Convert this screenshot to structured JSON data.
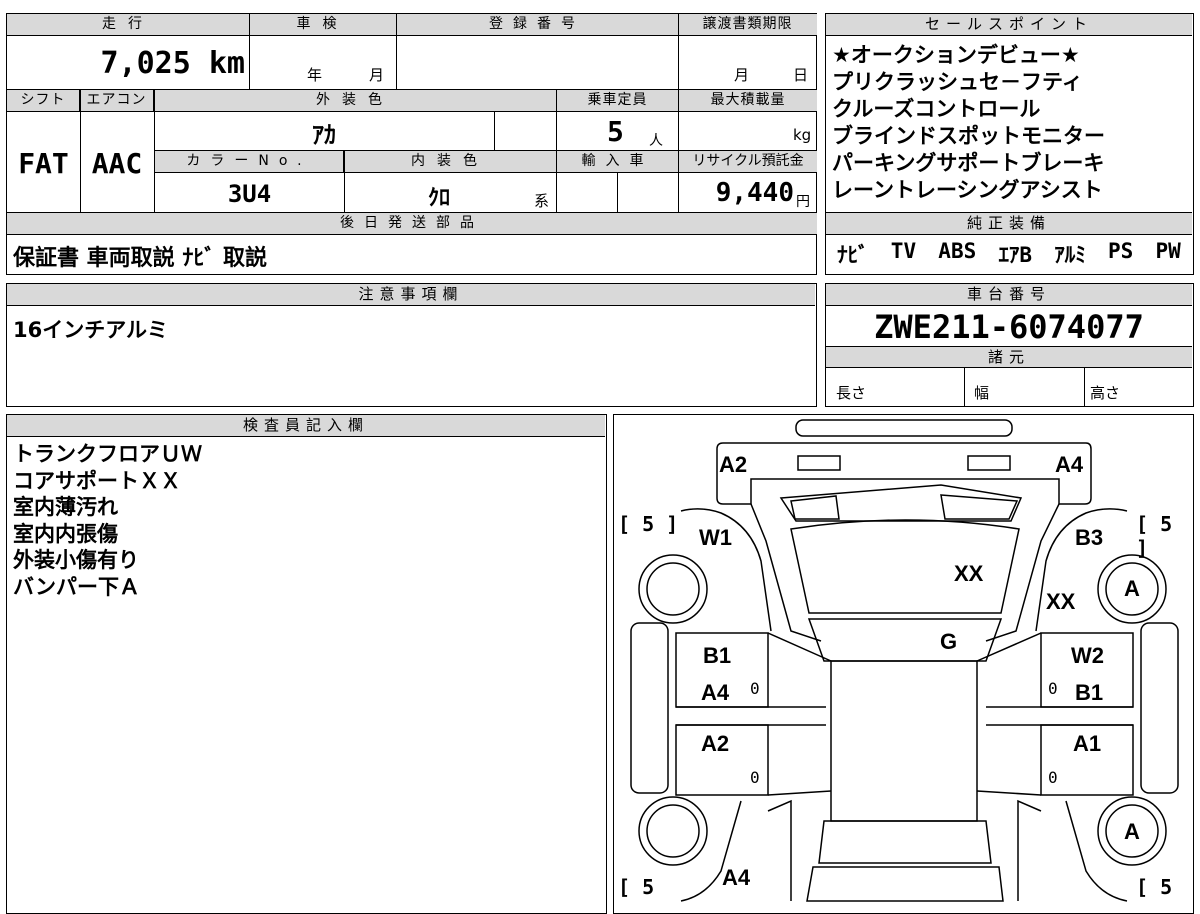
{
  "top": {
    "mileage_label": "走行",
    "mileage_value": "7,025 km",
    "inspection_label": "車検",
    "inspection_year_unit": "年",
    "inspection_month_unit": "月",
    "registration_label": "登録番号",
    "transfer_deadline_label": "譲渡書類期限",
    "transfer_month_unit": "月",
    "transfer_day_unit": "日",
    "shift_label": "シフト",
    "shift_value": "FAT",
    "aircon_label": "エアコン",
    "aircon_value": "AAC",
    "exterior_color_label": "外装色",
    "exterior_color_value": "ｱｶ",
    "capacity_label": "乗車定員",
    "capacity_value": "5",
    "capacity_unit": "人",
    "max_load_label": "最大積載量",
    "max_load_unit": "kg",
    "color_no_label": "カラーNo.",
    "color_no_value": "3U4",
    "interior_color_label": "内装色",
    "interior_color_value": "ｸﾛ",
    "interior_color_suffix": "系",
    "import_label": "輸入車",
    "recycle_label": "リサイクル預託金",
    "recycle_value": "9,440",
    "recycle_unit": "円",
    "later_parts_label": "後日発送部品",
    "later_parts_value": "保証書 車両取説 ﾅﾋﾞ 取説"
  },
  "sales_points": {
    "label": "セールスポイント",
    "items": [
      "★オークションデビュー★",
      "プリクラッシュセ－フティ",
      "クルーズコントロール",
      "ブラインドスポットモニター",
      "パーキングサポートブレーキ",
      "レーントレーシングアシスト"
    ]
  },
  "equipment": {
    "label": "純正装備",
    "items": [
      "ﾅﾋﾞ",
      "TV",
      "ABS",
      "ｴｱB",
      "ｱﾙﾐ",
      "PS",
      "PW"
    ]
  },
  "notes": {
    "label": "注意事項欄",
    "value": "16インチアルミ"
  },
  "chassis": {
    "label": "車台番号",
    "value": "ZWE211-6074077",
    "specs_label": "諸元",
    "length_label": "長さ",
    "width_label": "幅",
    "height_label": "高さ"
  },
  "inspector": {
    "label": "検査員記入欄",
    "lines": [
      "トランクフロアＵＷ",
      "コアサポートＸＸ",
      "室内薄汚れ",
      "室内内張傷",
      "外装小傷有り",
      "バンパー下Ａ"
    ]
  },
  "diagram": {
    "marks": {
      "rear_left": "A2",
      "rear_right": "A4",
      "tire_rl": "[ 5 ]",
      "tire_rr": "[ 5 ]",
      "tire_fl": "[ 5",
      "tire_fr": "[ 5",
      "qtr_left": "W1",
      "qtr_right": "B3",
      "roof": "XX",
      "right_rear_panel": "XX",
      "wheel_rr": "A",
      "windshield": "G",
      "rear_door_left_1": "B1",
      "rear_door_left_2": "A4",
      "rear_door_right_1": "W2",
      "rear_door_right_2": "B1",
      "front_door_left": "A2",
      "front_door_right": "A1",
      "wheel_fr": "A",
      "fender_left": "A4",
      "zero1": "0",
      "zero2": "0",
      "zero3": "0",
      "zero4": "0"
    }
  }
}
